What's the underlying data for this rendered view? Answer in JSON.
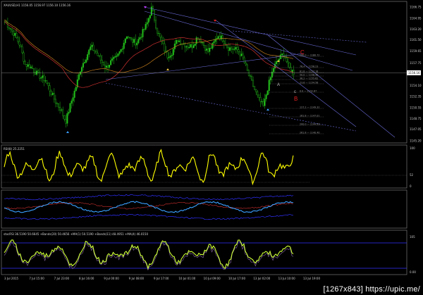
{
  "symbol_header": "XAUUSD,H1 1156.05 1156.97 1156.10 1156.16",
  "rsi_label": "RSI(8) 25.2251",
  "stoch_label": "stocRSI 36.5190 50.6645 +Bands(20) 50.4656 +MA(1) 50.5190 +Bands(11) 48.4951 +MA(4) 46.0150",
  "price_axis": [
    "1166.75",
    "1164.95",
    "1163.20",
    "1161.50",
    "1159.65",
    "1157.75",
    "1156.16",
    "1154.10",
    "1152.35",
    "1150.55",
    "1148.75",
    "1147.05",
    "1145.20"
  ],
  "current_price": "1156.16",
  "rsi_axis": {
    "top": "100",
    "mid": "52",
    "bottom": "0"
  },
  "stoch_axis": {
    "top": "105",
    "bottom": "0.00"
  },
  "time_axis": [
    "3 Jul 2015",
    "7 Jul 15:00",
    "7 Jul 23:00",
    "8 Jul 16:00",
    "9 Jul 00:00",
    "9 Jul 08:00",
    "9 Jul 17:00",
    "10 Jul 01:00",
    "10 Jul 09:00",
    "10 Jul 17:00",
    "13 Jul 02:00",
    "13 Jul 10:00",
    "13 Jul 19:00"
  ],
  "fib_levels": [
    "100.0 — 1160.72",
    "76.4 — 1158.23",
    "61.8 — 1157.18",
    "50.0 — 1156.40",
    "38.2 — 1155.62",
    "23.6 — 1154.58",
    "0.0 — 1152.87",
    "127.2 — 1149.32",
    "161.8 — 1147.01",
    "200.0 — 1144.49",
    "261.8 — 1140.40"
  ],
  "wave_labels": {
    "A": "A",
    "B": "B",
    "C": "C",
    "c": "c"
  },
  "watermark": "[1267x843] https://upic.me/",
  "colors": {
    "bull": "#22c01a",
    "bear": "#22c01a",
    "rsi": "#ffff00",
    "macd_main": "#3aa0ff",
    "ma_red": "#d03030",
    "ma_orange": "#c07a1a",
    "channel": "#6a6ad8",
    "stoch": "#ccff33",
    "bands": "#3030ff"
  },
  "chart_data": {
    "type": "candlestick",
    "title": "XAUUSD,H1 1156.05 1156.97 1156.10 1156.16",
    "ylim": [
      1145.2,
      1166.75
    ],
    "x_ticks": [
      "3 Jul 2015",
      "7 Jul 15:00",
      "7 Jul 23:00",
      "8 Jul 16:00",
      "9 Jul 00:00",
      "9 Jul 08:00",
      "9 Jul 17:00",
      "10 Jul 01:00",
      "10 Jul 09:00",
      "10 Jul 17:00",
      "13 Jul 02:00",
      "13 Jul 10:00",
      "13 Jul 19:00"
    ],
    "close_path": [
      1164.4,
      1163.4,
      1162.2,
      1160.6,
      1157.5,
      1157.2,
      1156.3,
      1155.5,
      1155.0,
      1153.2,
      1151.5,
      1150.3,
      1148.3,
      1151.2,
      1153.8,
      1157.0,
      1158.6,
      1160.4,
      1159.4,
      1158.1,
      1157.0,
      1158.0,
      1158.5,
      1160.0,
      1162.3,
      1161.3,
      1161.0,
      1162.4,
      1164.0,
      1166.7,
      1163.0,
      1161.0,
      1158.8,
      1159.5,
      1161.5,
      1161.0,
      1160.4,
      1160.5,
      1162.0,
      1161.0,
      1159.5,
      1160.6,
      1162.2,
      1161.6,
      1160.2,
      1160.0,
      1159.8,
      1158.4,
      1156.0,
      1154.0,
      1152.0,
      1150.7,
      1154.2,
      1157.0,
      1158.3,
      1159.3,
      1157.0,
      1156.2
    ]
  }
}
